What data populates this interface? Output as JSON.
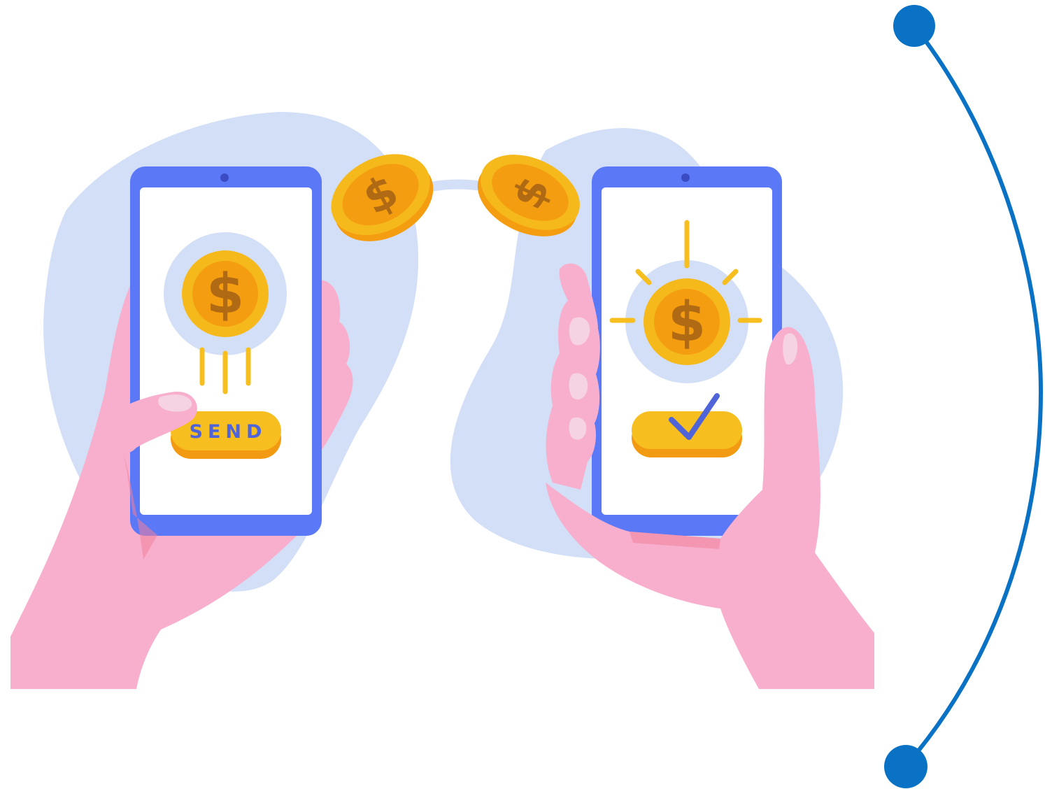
{
  "send_label": "SEND",
  "currency_symbol": "$",
  "colors": {
    "blob": "#d2dff7",
    "phone_frame": "#5b78f6",
    "phone_screen": "#ffffff",
    "skin": "#f8afcd",
    "skin_shadow": "#f07f9b",
    "coin_outer": "#f5b91c",
    "coin_inner": "#f49d10",
    "coin_symbol": "#b06a14",
    "button": "#f7be20",
    "button_shadow": "#f29a12",
    "button_text": "#4f64d9",
    "check": "#4f64d9",
    "arc_line": "#0a72c4"
  }
}
